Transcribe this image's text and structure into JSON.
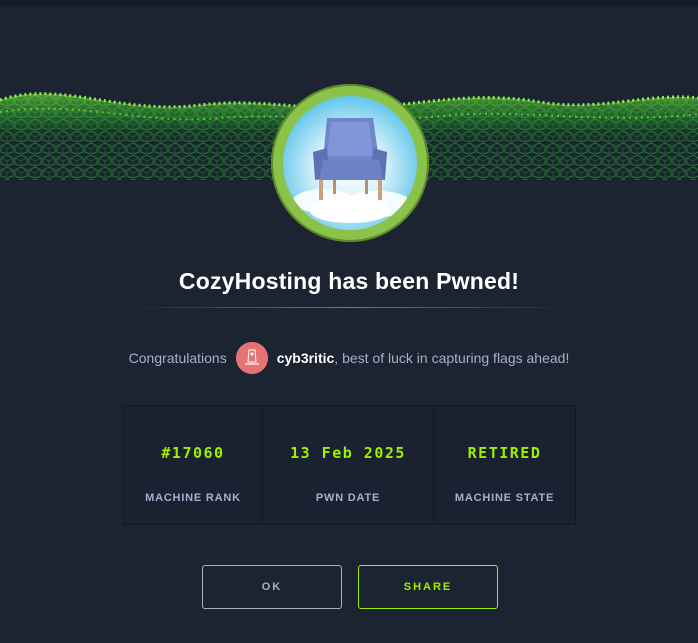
{
  "dialog": {
    "title": "CozyHosting has been Pwned!",
    "congrats_prefix": "Congratulations",
    "username": "cyb3ritic",
    "congrats_suffix": ", best of luck in capturing flags ahead!",
    "machine_icon": "armchair-in-clouds-icon",
    "stats": [
      {
        "value": "#17060",
        "label": "MACHINE RANK"
      },
      {
        "value": "13 Feb 2025",
        "label": "PWN DATE"
      },
      {
        "value": "RETIRED",
        "label": "MACHINE STATE"
      }
    ],
    "buttons": {
      "ok": "OK",
      "share": "SHARE"
    }
  },
  "colors": {
    "background": "#1c2331",
    "accent_green": "#9fef00",
    "muted_text": "#a4b1cd",
    "badge_ring": "#8bc34a",
    "avatar": "#e57373"
  }
}
